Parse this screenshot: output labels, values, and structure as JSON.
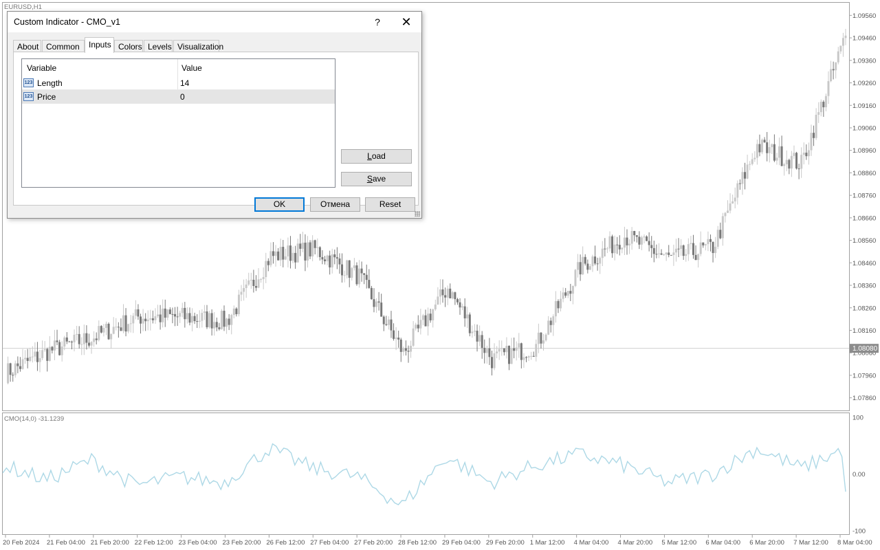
{
  "window": {
    "symbol_label": "EURUSD,H1"
  },
  "price_axis": {
    "ticks": [
      "1.09560",
      "1.09460",
      "1.09360",
      "1.09260",
      "1.09160",
      "1.09060",
      "1.08960",
      "1.08860",
      "1.08760",
      "1.08660",
      "1.08560",
      "1.08460",
      "1.08360",
      "1.08260",
      "1.08160",
      "1.08060",
      "1.07960",
      "1.07860"
    ],
    "current_price": "1.08080",
    "current_price_value": 1.0808
  },
  "indicator_pane": {
    "label": "CMO(14,0) -31.1239",
    "scale": [
      "100",
      "0.00",
      "-100"
    ]
  },
  "time_axis": {
    "labels": [
      "20 Feb 2024",
      "21 Feb 04:00",
      "21 Feb 20:00",
      "22 Feb 12:00",
      "23 Feb 04:00",
      "23 Feb 20:00",
      "26 Feb 12:00",
      "27 Feb 04:00",
      "27 Feb 20:00",
      "28 Feb 12:00",
      "29 Feb 04:00",
      "29 Feb 20:00",
      "1 Mar 12:00",
      "4 Mar 04:00",
      "4 Mar 20:00",
      "5 Mar 12:00",
      "6 Mar 04:00",
      "6 Mar 20:00",
      "7 Mar 12:00",
      "8 Mar 04:00"
    ]
  },
  "colors": {
    "candle_bull": "#c8c8c8",
    "candle_bear": "#787878",
    "cmo_line": "#add8e6",
    "axis_text": "#555555",
    "grid_line": "#e4e4e4",
    "current_price_bg": "#8c8c8c",
    "default_button_border": "#0078d7"
  },
  "chart_data": [
    {
      "type": "candlestick",
      "title": "EURUSD,H1",
      "y_axis": "price",
      "ylim": [
        1.0781,
        1.0961
      ],
      "x_range": [
        "20 Feb 2024",
        "8 Mar 04:00"
      ],
      "key_points": [
        {
          "x": "20 Feb 2024",
          "price": 1.0797
        },
        {
          "x": "21 Feb 04:00",
          "price": 1.0807
        },
        {
          "x": "21 Feb 20:00",
          "price": 1.0813
        },
        {
          "x": "22 Feb 12:00",
          "price": 1.0822
        },
        {
          "x": "23 Feb 04:00",
          "price": 1.0822
        },
        {
          "x": "23 Feb 20:00",
          "price": 1.082
        },
        {
          "x": "26 Feb 12:00",
          "price": 1.0849
        },
        {
          "x": "27 Feb 04:00",
          "price": 1.0852
        },
        {
          "x": "27 Feb 20:00",
          "price": 1.084
        },
        {
          "x": "28 Feb 12:00",
          "price": 1.0806
        },
        {
          "x": "29 Feb 04:00",
          "price": 1.0835
        },
        {
          "x": "29 Feb 20:00",
          "price": 1.0803
        },
        {
          "x": "1 Mar 12:00",
          "price": 1.0809
        },
        {
          "x": "4 Mar 04:00",
          "price": 1.0844
        },
        {
          "x": "4 Mar 20:00",
          "price": 1.0858
        },
        {
          "x": "5 Mar 12:00",
          "price": 1.0848
        },
        {
          "x": "6 Mar 04:00",
          "price": 1.0853
        },
        {
          "x": "6 Mar 20:00",
          "price": 1.0898
        },
        {
          "x": "7 Mar 12:00",
          "price": 1.089
        },
        {
          "x": "8 Mar 04:00",
          "price": 1.0947
        }
      ],
      "current_price": 1.0808
    },
    {
      "type": "line",
      "title": "CMO(14,0) -31.1239",
      "ylim": [
        -100,
        100
      ],
      "series": [
        {
          "name": "CMO(14,0)",
          "points": [
            {
              "x": "20 Feb 2024",
              "y": 15
            },
            {
              "x": "21 Feb 04:00",
              "y": -10
            },
            {
              "x": "21 Feb 20:00",
              "y": 25
            },
            {
              "x": "22 Feb 12:00",
              "y": -20
            },
            {
              "x": "23 Feb 04:00",
              "y": -5
            },
            {
              "x": "23 Feb 20:00",
              "y": -15
            },
            {
              "x": "26 Feb 12:00",
              "y": 45
            },
            {
              "x": "27 Feb 04:00",
              "y": 10
            },
            {
              "x": "27 Feb 20:00",
              "y": -5
            },
            {
              "x": "28 Feb 12:00",
              "y": -55
            },
            {
              "x": "29 Feb 04:00",
              "y": 30
            },
            {
              "x": "29 Feb 20:00",
              "y": -15
            },
            {
              "x": "1 Mar 12:00",
              "y": 15
            },
            {
              "x": "4 Mar 04:00",
              "y": 35
            },
            {
              "x": "4 Mar 20:00",
              "y": 15
            },
            {
              "x": "5 Mar 12:00",
              "y": -15
            },
            {
              "x": "6 Mar 04:00",
              "y": 0
            },
            {
              "x": "6 Mar 20:00",
              "y": 45
            },
            {
              "x": "7 Mar 12:00",
              "y": 10
            },
            {
              "x": "8 Mar 04:00",
              "y": 45
            }
          ],
          "last_value": -31.1239
        }
      ]
    }
  ],
  "dialog": {
    "title": "Custom Indicator - CMO_v1",
    "help_glyph": "?",
    "close_glyph": "✕",
    "tabs": [
      {
        "label": "About",
        "active": false
      },
      {
        "label": "Common",
        "active": false
      },
      {
        "label": "Inputs",
        "active": true
      },
      {
        "label": "Colors",
        "active": false
      },
      {
        "label": "Levels",
        "active": false
      },
      {
        "label": "Visualization",
        "active": false
      }
    ],
    "grid": {
      "headers": {
        "variable": "Variable",
        "value": "Value"
      },
      "type_icon": "123",
      "rows": [
        {
          "variable": "Length",
          "value": "14",
          "selected": false
        },
        {
          "variable": "Price",
          "value": "0",
          "selected": true
        }
      ]
    },
    "buttons": {
      "load": {
        "accel": "L",
        "rest": "oad"
      },
      "save": {
        "accel": "S",
        "rest": "ave"
      },
      "ok": "OK",
      "cancel": "Отмена",
      "reset": "Reset"
    }
  }
}
